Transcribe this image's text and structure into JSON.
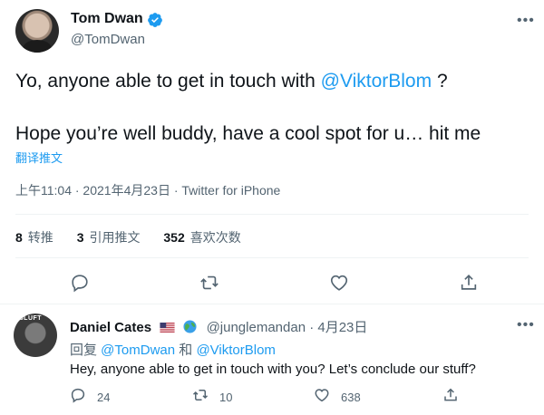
{
  "tweet": {
    "author_name": "Tom Dwan",
    "author_handle": "@TomDwan",
    "line1_text": "Yo, anyone able to get in touch with ",
    "line1_mention": "@ViktorBlom",
    "line1_suffix": " ?",
    "line2_text": "Hope you’re well buddy, have a cool spot for u… hit me",
    "translate_label": "翻译推文",
    "meta": "上午11:04 · 2021年4月23日 · Twitter for iPhone",
    "stats": [
      {
        "num": "8",
        "label": "转推"
      },
      {
        "num": "3",
        "label": "引用推文"
      },
      {
        "num": "352",
        "label": "喜欢次数"
      }
    ],
    "accent": "#1d9bf0",
    "actions": [
      "reply-icon",
      "retweet-icon",
      "like-icon",
      "share-icon"
    ]
  },
  "reply": {
    "author_name": "Daniel Cates",
    "author_handle": "@junglemandan",
    "separator": "·",
    "date": "4月23日",
    "avatar_tag": "SLUFT",
    "replying_prefix": "回复 ",
    "replying_mention1": "@TomDwan",
    "replying_and": " 和 ",
    "replying_mention2": "@ViktorBlom",
    "text": "Hey, anyone able to get in touch with you? Let’s conclude our stuff?",
    "counts": {
      "reply": "24",
      "retweet": "10",
      "like": "638"
    }
  }
}
